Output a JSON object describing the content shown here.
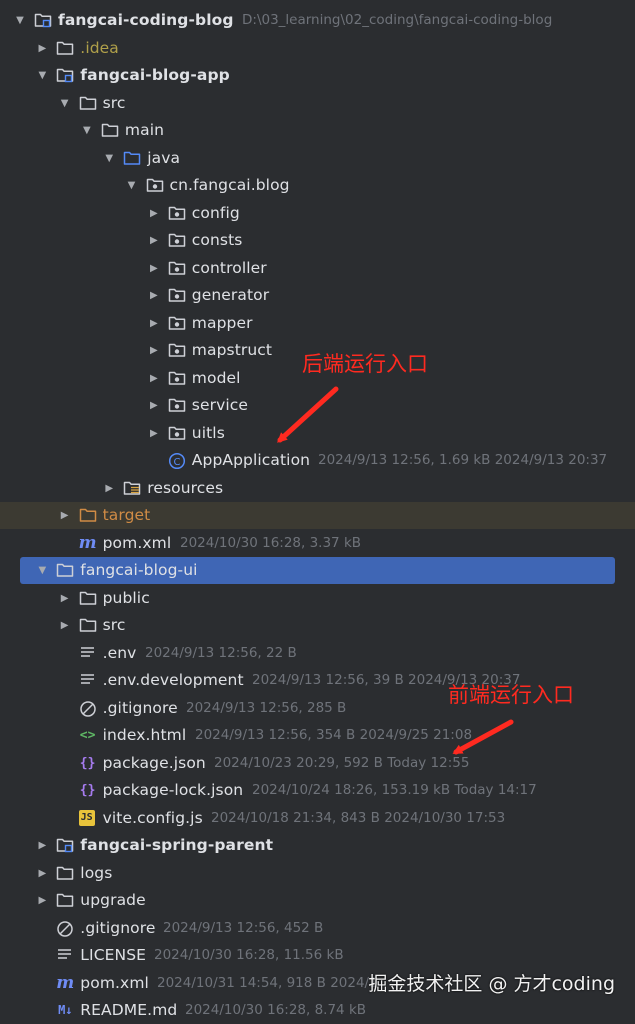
{
  "colors": {
    "background": "#2b2d30",
    "selection": "#3f66b5",
    "excluded_row": "#3c3a32",
    "idea_folder_text": "#b0a04a",
    "target_folder_text": "#d08b45",
    "metadata_text": "#6f737a",
    "annotation": "#ff2a20",
    "class_icon": "#548af7",
    "json_icon": "#a77cf0",
    "html_icon": "#5fb865",
    "js_icon": "#e8c33b"
  },
  "tree": [
    {
      "name": "fangcai-coding-blog",
      "meta": "D:\\03_learning\\02_coding\\fangcai-coding-blog",
      "depth": 0,
      "chevron": "open",
      "icon": "module-folder-icon",
      "bold": true,
      "selected": false,
      "color": ""
    },
    {
      "name": ".idea",
      "meta": "",
      "depth": 1,
      "chevron": "closed",
      "icon": "folder-icon",
      "bold": false,
      "selected": false,
      "color": "#b0a04a"
    },
    {
      "name": "fangcai-blog-app",
      "meta": "",
      "depth": 1,
      "chevron": "open",
      "icon": "module-folder-icon",
      "bold": true,
      "selected": false,
      "color": ""
    },
    {
      "name": "src",
      "meta": "",
      "depth": 2,
      "chevron": "open",
      "icon": "folder-icon",
      "bold": false,
      "selected": false,
      "color": ""
    },
    {
      "name": "main",
      "meta": "",
      "depth": 3,
      "chevron": "open",
      "icon": "folder-icon",
      "bold": false,
      "selected": false,
      "color": ""
    },
    {
      "name": "java",
      "meta": "",
      "depth": 4,
      "chevron": "open",
      "icon": "source-folder-icon",
      "bold": false,
      "selected": false,
      "color": ""
    },
    {
      "name": "cn.fangcai.blog",
      "meta": "",
      "depth": 5,
      "chevron": "open",
      "icon": "package-icon",
      "bold": false,
      "selected": false,
      "color": ""
    },
    {
      "name": "config",
      "meta": "",
      "depth": 6,
      "chevron": "closed",
      "icon": "package-icon",
      "bold": false,
      "selected": false,
      "color": ""
    },
    {
      "name": "consts",
      "meta": "",
      "depth": 6,
      "chevron": "closed",
      "icon": "package-icon",
      "bold": false,
      "selected": false,
      "color": ""
    },
    {
      "name": "controller",
      "meta": "",
      "depth": 6,
      "chevron": "closed",
      "icon": "package-icon",
      "bold": false,
      "selected": false,
      "color": ""
    },
    {
      "name": "generator",
      "meta": "",
      "depth": 6,
      "chevron": "closed",
      "icon": "package-icon",
      "bold": false,
      "selected": false,
      "color": ""
    },
    {
      "name": "mapper",
      "meta": "",
      "depth": 6,
      "chevron": "closed",
      "icon": "package-icon",
      "bold": false,
      "selected": false,
      "color": ""
    },
    {
      "name": "mapstruct",
      "meta": "",
      "depth": 6,
      "chevron": "closed",
      "icon": "package-icon",
      "bold": false,
      "selected": false,
      "color": ""
    },
    {
      "name": "model",
      "meta": "",
      "depth": 6,
      "chevron": "closed",
      "icon": "package-icon",
      "bold": false,
      "selected": false,
      "color": ""
    },
    {
      "name": "service",
      "meta": "",
      "depth": 6,
      "chevron": "closed",
      "icon": "package-icon",
      "bold": false,
      "selected": false,
      "color": ""
    },
    {
      "name": "uitls",
      "meta": "",
      "depth": 6,
      "chevron": "closed",
      "icon": "package-icon",
      "bold": false,
      "selected": false,
      "color": ""
    },
    {
      "name": "AppApplication",
      "meta": "2024/9/13 12:56, 1.69 kB 2024/9/13 20:37",
      "depth": 6,
      "chevron": "none",
      "icon": "java-class-icon",
      "bold": false,
      "selected": false,
      "color": ""
    },
    {
      "name": "resources",
      "meta": "",
      "depth": 4,
      "chevron": "closed",
      "icon": "resources-folder-icon",
      "bold": false,
      "selected": false,
      "color": ""
    },
    {
      "name": "target",
      "meta": "",
      "depth": 2,
      "chevron": "closed",
      "icon": "excluded-folder-icon",
      "bold": false,
      "selected": false,
      "color": "#d08b45",
      "excluded": true
    },
    {
      "name": "pom.xml",
      "meta": "2024/10/30 16:28, 3.37 kB",
      "depth": 2,
      "chevron": "none",
      "icon": "maven-icon",
      "bold": false,
      "selected": false,
      "color": ""
    },
    {
      "name": "fangcai-blog-ui",
      "meta": "",
      "depth": 1,
      "chevron": "open",
      "icon": "folder-icon",
      "bold": false,
      "selected": true,
      "color": ""
    },
    {
      "name": "public",
      "meta": "",
      "depth": 2,
      "chevron": "closed",
      "icon": "folder-icon",
      "bold": false,
      "selected": false,
      "color": ""
    },
    {
      "name": "src",
      "meta": "",
      "depth": 2,
      "chevron": "closed",
      "icon": "folder-icon",
      "bold": false,
      "selected": false,
      "color": ""
    },
    {
      "name": ".env",
      "meta": "2024/9/13 12:56, 22 B",
      "depth": 2,
      "chevron": "none",
      "icon": "text-file-icon",
      "bold": false,
      "selected": false,
      "color": ""
    },
    {
      "name": ".env.development",
      "meta": "2024/9/13 12:56, 39 B 2024/9/13 20:37",
      "depth": 2,
      "chevron": "none",
      "icon": "text-file-icon",
      "bold": false,
      "selected": false,
      "color": ""
    },
    {
      "name": ".gitignore",
      "meta": "2024/9/13 12:56, 285 B",
      "depth": 2,
      "chevron": "none",
      "icon": "ignore-file-icon",
      "bold": false,
      "selected": false,
      "color": ""
    },
    {
      "name": "index.html",
      "meta": "2024/9/13 12:56, 354 B 2024/9/25 21:08",
      "depth": 2,
      "chevron": "none",
      "icon": "html-file-icon",
      "bold": false,
      "selected": false,
      "color": ""
    },
    {
      "name": "package.json",
      "meta": "2024/10/23 20:29, 592 B Today 12:55",
      "depth": 2,
      "chevron": "none",
      "icon": "json-file-icon",
      "bold": false,
      "selected": false,
      "color": ""
    },
    {
      "name": "package-lock.json",
      "meta": "2024/10/24 18:26, 153.19 kB Today 14:17",
      "depth": 2,
      "chevron": "none",
      "icon": "json-file-icon",
      "bold": false,
      "selected": false,
      "color": ""
    },
    {
      "name": "vite.config.js",
      "meta": "2024/10/18 21:34, 843 B 2024/10/30 17:53",
      "depth": 2,
      "chevron": "none",
      "icon": "js-file-icon",
      "bold": false,
      "selected": false,
      "color": ""
    },
    {
      "name": "fangcai-spring-parent",
      "meta": "",
      "depth": 1,
      "chevron": "closed",
      "icon": "module-folder-icon",
      "bold": true,
      "selected": false,
      "color": ""
    },
    {
      "name": "logs",
      "meta": "",
      "depth": 1,
      "chevron": "closed",
      "icon": "folder-icon",
      "bold": false,
      "selected": false,
      "color": ""
    },
    {
      "name": "upgrade",
      "meta": "",
      "depth": 1,
      "chevron": "closed",
      "icon": "folder-icon",
      "bold": false,
      "selected": false,
      "color": ""
    },
    {
      "name": ".gitignore",
      "meta": "2024/9/13 12:56, 452 B",
      "depth": 1,
      "chevron": "none",
      "icon": "ignore-file-icon",
      "bold": false,
      "selected": false,
      "color": ""
    },
    {
      "name": "LICENSE",
      "meta": "2024/10/30 16:28, 11.56 kB",
      "depth": 1,
      "chevron": "none",
      "icon": "text-file-icon",
      "bold": false,
      "selected": false,
      "color": ""
    },
    {
      "name": "pom.xml",
      "meta": "2024/10/31 14:54, 918 B 2024/1",
      "depth": 1,
      "chevron": "none",
      "icon": "maven-icon",
      "bold": false,
      "selected": false,
      "color": ""
    },
    {
      "name": "README.md",
      "meta": "2024/10/30 16:28, 8.74 kB",
      "depth": 1,
      "chevron": "none",
      "icon": "markdown-file-icon",
      "bold": false,
      "selected": false,
      "color": ""
    }
  ],
  "annotations": {
    "backend_entry": "后端运行入口",
    "frontend_entry": "前端运行入口"
  },
  "watermark": "掘金技术社区 @ 方才coding"
}
